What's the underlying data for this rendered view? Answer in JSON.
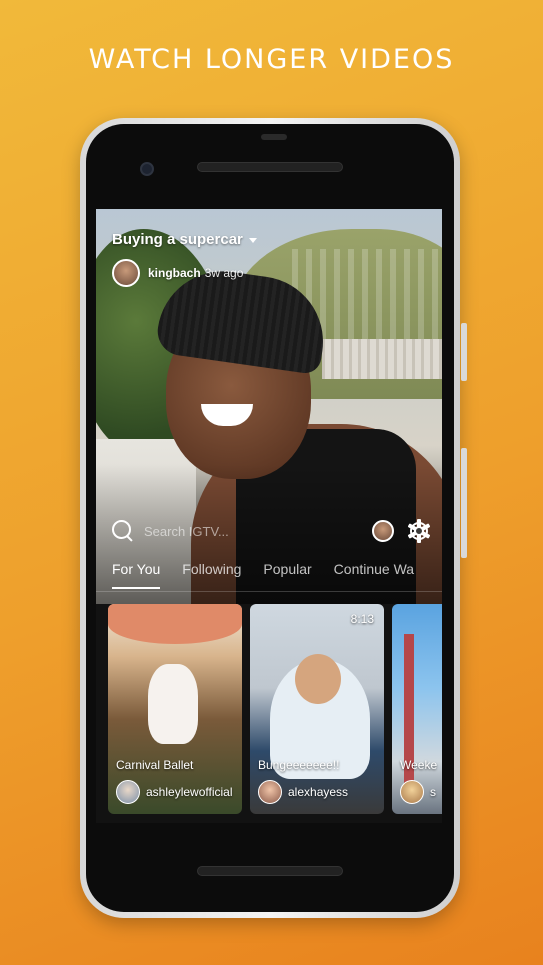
{
  "headline": "WATCH LONGER VIDEOS",
  "video": {
    "title": "Buying a supercar",
    "author": "kingbach",
    "time_ago": "3w ago"
  },
  "search": {
    "placeholder": "Search IGTV..."
  },
  "tabs": [
    {
      "label": "For You",
      "active": true
    },
    {
      "label": "Following",
      "active": false
    },
    {
      "label": "Popular",
      "active": false
    },
    {
      "label": "Continue Wa",
      "active": false
    }
  ],
  "cards": [
    {
      "title": "Carnival Ballet",
      "user": "ashleylewofficial",
      "duration": ""
    },
    {
      "title": "Bungeeeeeee!!",
      "user": "alexhayess",
      "duration": "8:13"
    },
    {
      "title": "Weeke",
      "user": "s",
      "duration": ""
    }
  ],
  "colors": {
    "background_start": "#f1b93a",
    "background_end": "#e8821e",
    "screen_bg": "#121212",
    "text": "#ffffff"
  },
  "icons": [
    "search-icon",
    "settings-icon",
    "profile-icon",
    "caret-down-icon"
  ]
}
